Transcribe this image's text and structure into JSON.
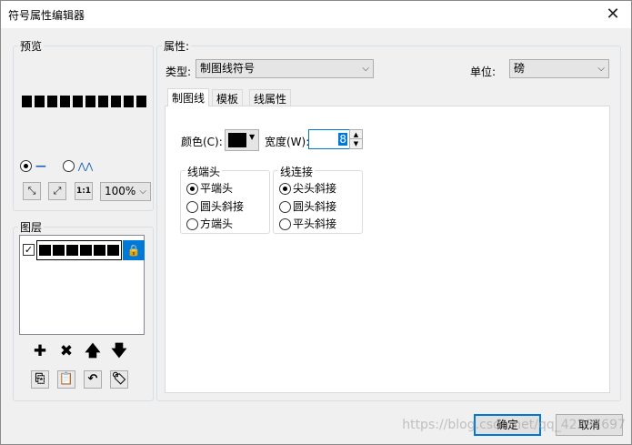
{
  "window": {
    "title": "符号属性编辑器",
    "close_glyph": "✕"
  },
  "preview": {
    "label": "预览",
    "radio_line": "—",
    "radio_wave": "⋀⋀",
    "zoom_value": "100%"
  },
  "layers": {
    "label": "图层",
    "checked_glyph": "✓"
  },
  "properties": {
    "label": "属性:",
    "type_label": "类型:",
    "type_value": "制图线符号",
    "unit_label": "单位:",
    "unit_value": "磅"
  },
  "tabs": [
    {
      "label": "制图线"
    },
    {
      "label": "模板"
    },
    {
      "label": "线属性"
    }
  ],
  "line_props": {
    "color_label": "颜色(C):",
    "color_value": "#000000",
    "width_label": "宽度(W):",
    "width_value": "8",
    "caps_label": "线端头",
    "caps": [
      "平端头",
      "圆头斜接",
      "方端头"
    ],
    "joins_label": "线连接",
    "joins": [
      "尖头斜接",
      "圆头斜接",
      "平头斜接"
    ]
  },
  "buttons": {
    "ok": "确定",
    "cancel": "取消"
  },
  "watermark": "https://blog.csdn.net/qq_42297697"
}
